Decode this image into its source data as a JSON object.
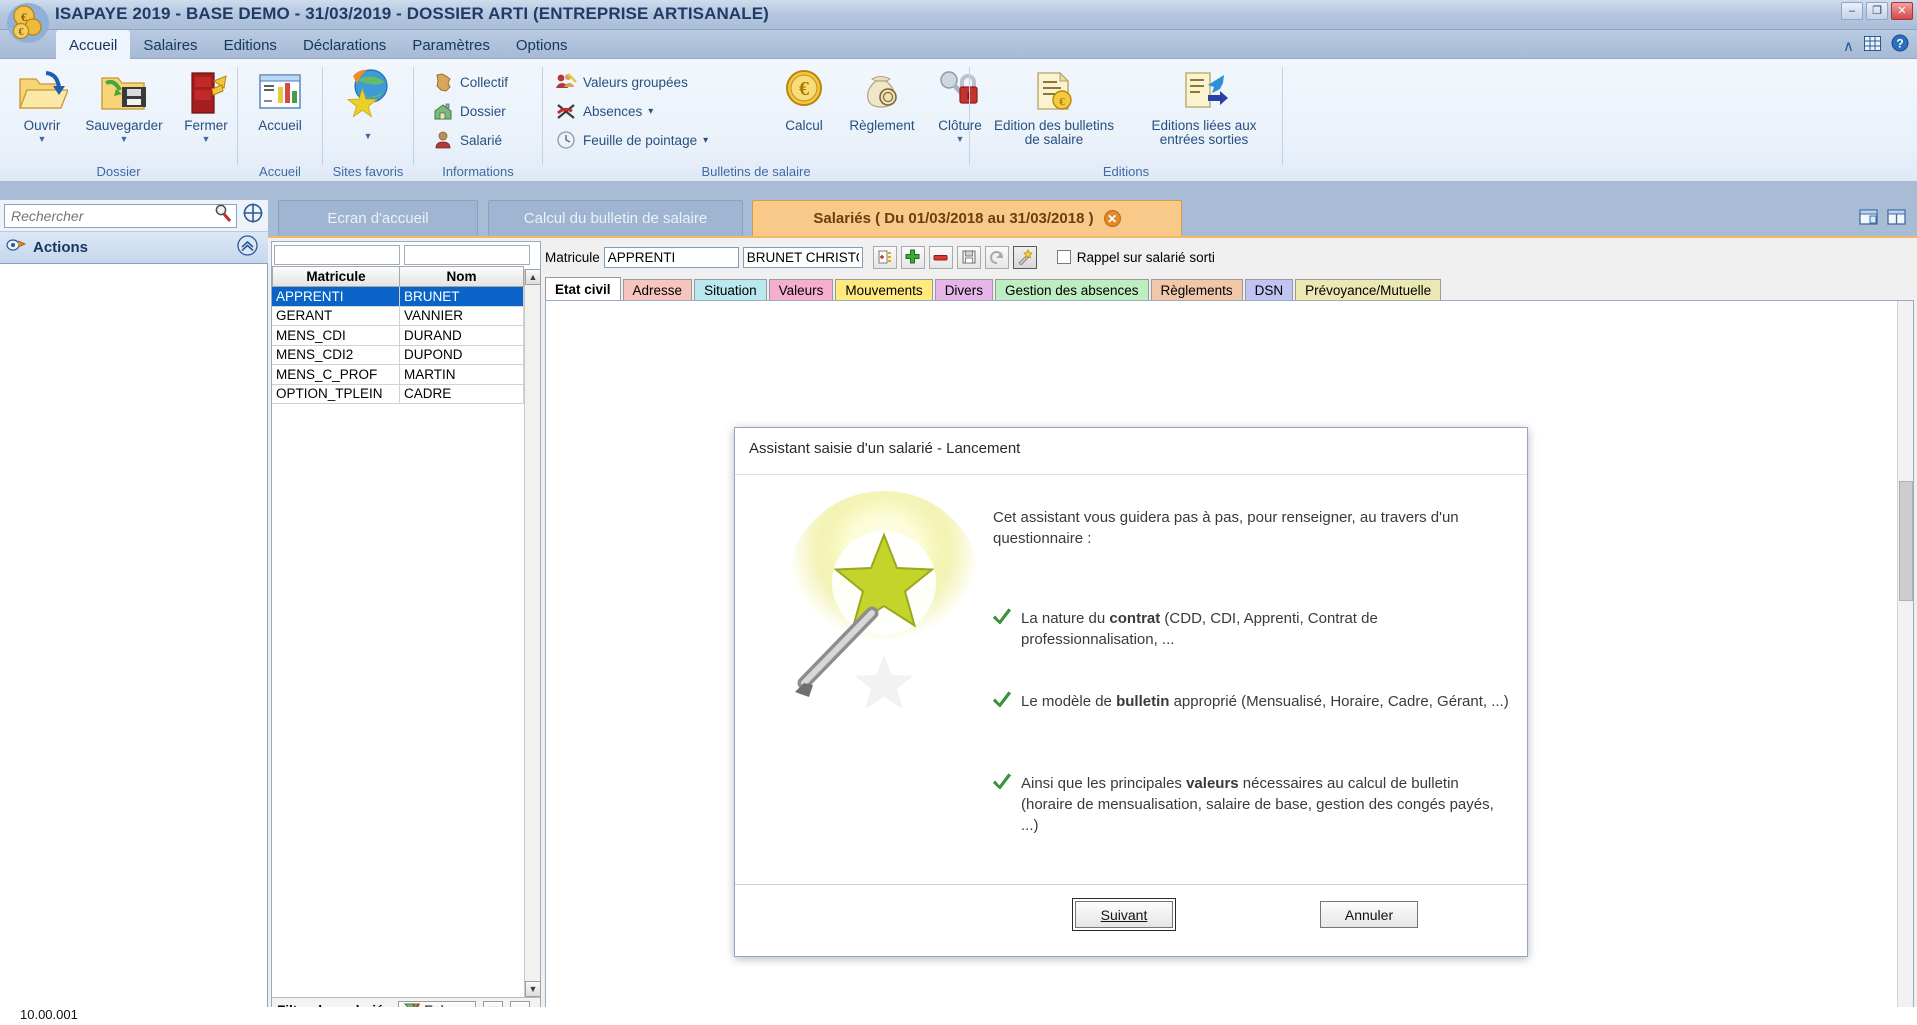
{
  "window": {
    "title": "ISAPAYE 2019 - BASE DEMO - 31/03/2019 - DOSSIER ARTI (ENTREPRISE ARTISANALE)",
    "minimize": "–",
    "restore": "❐",
    "close": "✕"
  },
  "menu": {
    "items": [
      {
        "label": "Accueil",
        "active": true
      },
      {
        "label": "Salaires",
        "active": false
      },
      {
        "label": "Editions",
        "active": false
      },
      {
        "label": "Déclarations",
        "active": false
      },
      {
        "label": "Paramètres",
        "active": false
      },
      {
        "label": "Options",
        "active": false
      }
    ],
    "right": {
      "collapse": "∧",
      "grid": "grid-icon",
      "help": "?"
    }
  },
  "ribbon": {
    "groups": [
      {
        "label": "Dossier"
      },
      {
        "label": "Accueil"
      },
      {
        "label": "Sites favoris"
      },
      {
        "label": "Informations"
      },
      {
        "label": "Bulletins de salaire"
      },
      {
        "label": "Editions"
      }
    ],
    "dossier": [
      {
        "label": "Ouvrir",
        "icon": "open-folder-icon",
        "caret": "▼"
      },
      {
        "label": "Sauvegarder",
        "icon": "save-folder-icon",
        "caret": "▼"
      },
      {
        "label": "Fermer",
        "icon": "close-door-icon",
        "caret": "▼"
      }
    ],
    "accueil": [
      {
        "label": "Accueil",
        "icon": "dashboard-icon"
      }
    ],
    "favoris": [
      {
        "label": "",
        "icon": "globe-star-icon",
        "caret": "▼"
      }
    ],
    "informations": [
      {
        "label": "Collectif",
        "icon": "france-map-icon"
      },
      {
        "label": "Dossier",
        "icon": "house-icon"
      },
      {
        "label": "Salarié",
        "icon": "person-icon"
      }
    ],
    "bulletins_small": [
      {
        "label": "Valeurs groupées",
        "icon": "group-values-icon",
        "caret": ""
      },
      {
        "label": "Absences",
        "icon": "absence-icon",
        "caret": "▾"
      },
      {
        "label": "Feuille de pointage",
        "icon": "clock-icon",
        "caret": "▾"
      }
    ],
    "bulletins_big": [
      {
        "label": "Calcul",
        "icon": "euro-coin-icon",
        "caret": ""
      },
      {
        "label": "Règlement",
        "icon": "money-bag-icon",
        "caret": ""
      },
      {
        "label": "Clôture",
        "icon": "lock-key-icon",
        "caret": "▼"
      }
    ],
    "editions_big": [
      {
        "label": "Edition des bulletins\nde salaire",
        "icon": "payslip-icon",
        "caret": "▾"
      },
      {
        "label": "Editions liées aux\nentrées sorties",
        "icon": "inout-doc-icon",
        "caret": "▾"
      }
    ]
  },
  "search": {
    "placeholder": "Rechercher",
    "value": "",
    "icon": "search-icon",
    "target_icon": "target-icon"
  },
  "actions_panel": {
    "label": "Actions",
    "icon": "actions-icon",
    "collapse_icon": "chevrons-up-icon"
  },
  "doc_tabs": [
    {
      "label": "Ecran d'accueil",
      "active": false,
      "closable": false
    },
    {
      "label": "Calcul du bulletin de salaire",
      "active": false,
      "closable": false
    },
    {
      "label": "Salariés ( Du 01/03/2018 au 31/03/2018 )",
      "active": true,
      "closable": true,
      "close_glyph": "✕"
    }
  ],
  "tabstrip_right": {
    "restore_icon": "window-restore-icon",
    "split_icon": "window-split-icon"
  },
  "grid": {
    "filter_matricule": "",
    "filter_nom": "",
    "columns": [
      "Matricule",
      "Nom"
    ],
    "rows": [
      {
        "matricule": "APPRENTI",
        "nom": "BRUNET",
        "selected": true
      },
      {
        "matricule": "GERANT",
        "nom": "VANNIER",
        "selected": false
      },
      {
        "matricule": "MENS_CDI",
        "nom": "DURAND",
        "selected": false
      },
      {
        "matricule": "MENS_CDI2",
        "nom": "DUPOND",
        "selected": false
      },
      {
        "matricule": "MENS_C_PROF",
        "nom": "MARTIN",
        "selected": false
      },
      {
        "matricule": "OPTION_TPLEIN",
        "nom": "CADRE",
        "selected": false
      }
    ],
    "scroll_up": "▲",
    "scroll_down": "▼",
    "footer": {
      "filter_link": "Filtre des salariés",
      "remove_label": "Enlever",
      "remove_icon": "filter-remove-icon",
      "sort_desc": "▽",
      "sort_asc": "△"
    }
  },
  "form": {
    "matricule_label": "Matricule",
    "matricule_value": "APPRENTI",
    "name_value": "BRUNET CHRISTOPHE",
    "toolbar": [
      {
        "name": "duplicate-button",
        "icon": "duplicate-icon"
      },
      {
        "name": "add-button",
        "icon": "plus-icon"
      },
      {
        "name": "delete-button",
        "icon": "minus-icon"
      },
      {
        "name": "save-button",
        "icon": "save-icon"
      },
      {
        "name": "undo-button",
        "icon": "undo-icon"
      },
      {
        "name": "wizard-button",
        "icon": "magic-wand-icon"
      }
    ],
    "checkbox_label": "Rappel sur salarié sorti",
    "checkbox_checked": false,
    "tabs": [
      {
        "label": "Etat civil",
        "color": "#ffffff",
        "active": true
      },
      {
        "label": "Adresse",
        "color": "#f6c5bd",
        "active": false
      },
      {
        "label": "Situation",
        "color": "#b9e8ef",
        "active": false
      },
      {
        "label": "Valeurs",
        "color": "#f6aece",
        "active": false
      },
      {
        "label": "Mouvements",
        "color": "#ffea80",
        "active": false
      },
      {
        "label": "Divers",
        "color": "#e7b6e8",
        "active": false
      },
      {
        "label": "Gestion des absences",
        "color": "#bdedc1",
        "active": false
      },
      {
        "label": "Règlements",
        "color": "#f0c7a9",
        "active": false
      },
      {
        "label": "DSN",
        "color": "#bfc4f2",
        "active": false
      },
      {
        "label": "Prévoyance/Mutuelle",
        "color": "#ece8b4",
        "active": false
      }
    ]
  },
  "dialog": {
    "title": "Assistant saisie d'un salarié - Lancement",
    "intro": "Cet assistant vous guidera pas à pas, pour renseigner, au travers d'un questionnaire :",
    "bullets": [
      {
        "pre": "La nature du ",
        "strong": "contrat",
        "post": " (CDD, CDI, Apprenti, Contrat de professionnalisation, ..."
      },
      {
        "pre": "Le modèle de ",
        "strong": "bulletin",
        "post": " approprié (Mensualisé, Horaire, Cadre, Gérant, ...)"
      },
      {
        "pre": "Ainsi que les principales ",
        "strong": "valeurs",
        "post": " nécessaires au calcul de bulletin\n(horaire de mensualisation, salaire de base, gestion des congés payés, ...)"
      }
    ],
    "check_icon": "green-check-icon",
    "wand_icon": "magic-wand-large-icon",
    "next_button": "Suivant",
    "next_accesskey": "S",
    "cancel_button": "Annuler"
  },
  "status": {
    "version": "10.00.001"
  }
}
